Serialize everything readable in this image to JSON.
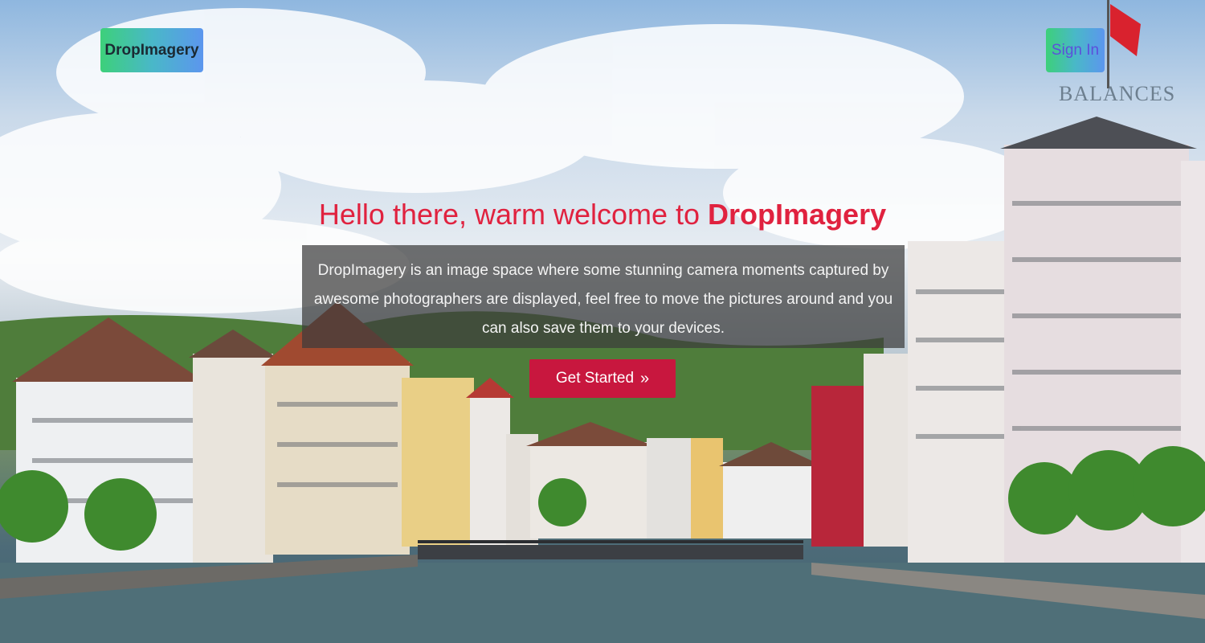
{
  "header": {
    "brand_label": "DropImagery",
    "signin_label": "Sign In"
  },
  "hero": {
    "headline_prefix": "Hello there, warm welcome to ",
    "headline_brand": "DropImagery",
    "description": "DropImagery is an image space where some stunning camera moments captured by awesome photographers are displayed, feel free to move the pictures around and you can also save them to your devices.",
    "cta_label": "Get Started",
    "cta_icon": "»",
    "background_sign_text": "BALANCES"
  },
  "colors": {
    "accent": "#e0223f",
    "cta_bg": "#c8173e",
    "button_gradient_start": "#3dd07a",
    "button_gradient_end": "#5c96ee"
  },
  "icons": {
    "cta": "double-chevron-right-icon"
  }
}
